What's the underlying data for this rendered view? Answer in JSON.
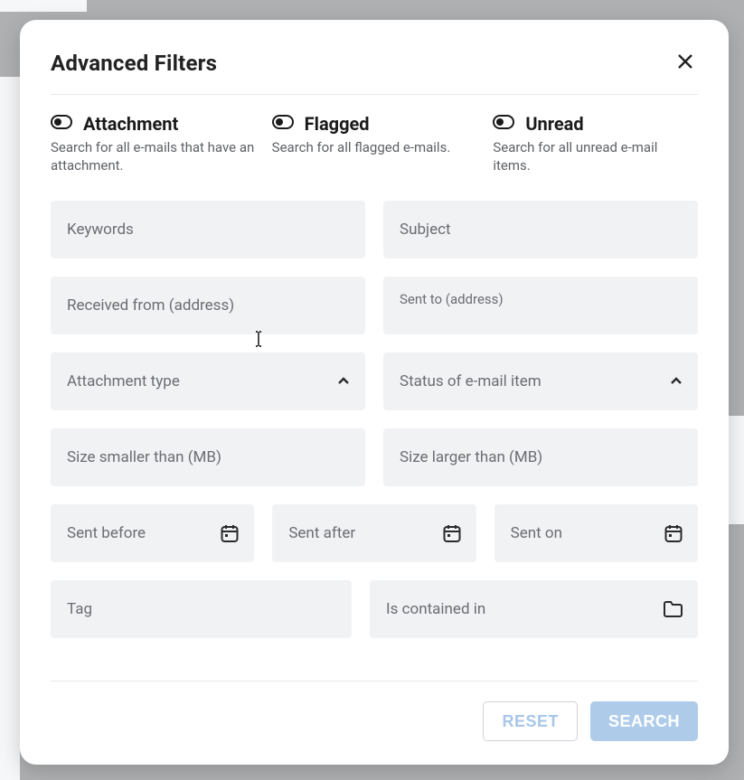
{
  "modal": {
    "title": "Advanced Filters",
    "toggles": {
      "attachment": {
        "label": "Attachment",
        "desc": "Search for all e-mails that have an attachment."
      },
      "flagged": {
        "label": "Flagged",
        "desc": "Search for all flagged e-mails."
      },
      "unread": {
        "label": "Unread",
        "desc": "Search for all unread e-mail items."
      }
    },
    "fields": {
      "keywords": {
        "placeholder": "Keywords"
      },
      "subject": {
        "placeholder": "Subject"
      },
      "received_from": {
        "placeholder": "Received from (address)"
      },
      "sent_to": {
        "placeholder": "Sent to (address)"
      },
      "attachment_type": {
        "placeholder": "Attachment type"
      },
      "status": {
        "placeholder": "Status of e-mail item"
      },
      "size_smaller": {
        "placeholder": "Size smaller than (MB)"
      },
      "size_larger": {
        "placeholder": "Size larger than (MB)"
      },
      "sent_before": {
        "placeholder": "Sent before"
      },
      "sent_after": {
        "placeholder": "Sent after"
      },
      "sent_on": {
        "placeholder": "Sent on"
      },
      "tag": {
        "placeholder": "Tag"
      },
      "contained_in": {
        "placeholder": "Is contained in"
      }
    },
    "buttons": {
      "reset": "RESET",
      "search": "SEARCH"
    }
  }
}
